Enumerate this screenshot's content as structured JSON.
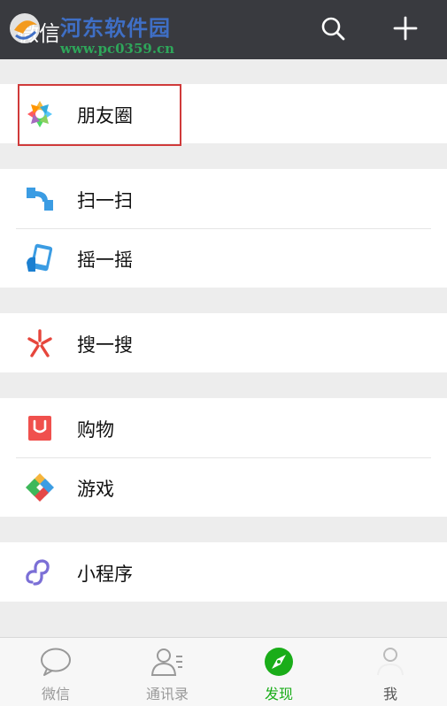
{
  "header": {
    "title": "微信",
    "watermark_title": "河东软件园",
    "watermark_url": "www.pc0359.cn",
    "search_icon": "search-icon",
    "add_icon": "plus-icon"
  },
  "groups": [
    {
      "items": [
        {
          "label": "朋友圈",
          "icon": "moments-icon"
        }
      ]
    },
    {
      "items": [
        {
          "label": "扫一扫",
          "icon": "scan-icon"
        },
        {
          "label": "摇一摇",
          "icon": "shake-icon"
        }
      ]
    },
    {
      "items": [
        {
          "label": "搜一搜",
          "icon": "search-one-icon"
        }
      ]
    },
    {
      "items": [
        {
          "label": "购物",
          "icon": "shopping-icon"
        },
        {
          "label": "游戏",
          "icon": "games-icon"
        }
      ]
    },
    {
      "items": [
        {
          "label": "小程序",
          "icon": "mini-program-icon"
        }
      ]
    }
  ],
  "tabbar": {
    "tabs": [
      {
        "label": "微信",
        "icon": "chat-icon"
      },
      {
        "label": "通讯录",
        "icon": "contacts-icon"
      },
      {
        "label": "发现",
        "icon": "discover-icon",
        "active": true
      },
      {
        "label": "我",
        "icon": "me-icon"
      }
    ],
    "active_color": "#1aad19"
  },
  "colors": {
    "header_bg": "#393a3f",
    "highlight_border": "#d03a3a"
  }
}
